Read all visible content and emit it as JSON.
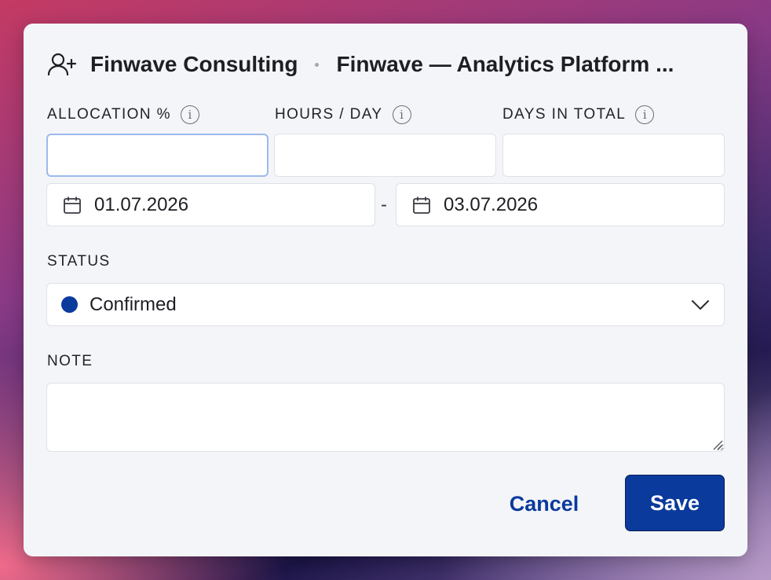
{
  "header": {
    "client": "Finwave Consulting",
    "project": "Finwave — Analytics Platform ..."
  },
  "fields": {
    "allocation": {
      "label": "ALLOCATION %",
      "value": ""
    },
    "hours_per_day": {
      "label": "HOURS / DAY",
      "value": ""
    },
    "days_in_total": {
      "label": "DAYS IN TOTAL",
      "value": ""
    }
  },
  "dates": {
    "start": "01.07.2026",
    "separator": "-",
    "end": "03.07.2026"
  },
  "status": {
    "label": "STATUS",
    "selected": "Confirmed",
    "color": "#0a3a9c"
  },
  "note": {
    "label": "NOTE",
    "value": ""
  },
  "actions": {
    "cancel": "Cancel",
    "save": "Save"
  },
  "colors": {
    "primary": "#0a3a9c",
    "dialog_bg": "#f4f5f9"
  },
  "icons": {
    "header": "add-user-icon",
    "info": "info-icon",
    "date": "calendar-icon",
    "select": "chevron-down-icon"
  }
}
